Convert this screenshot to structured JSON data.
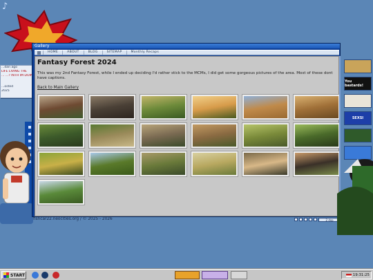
{
  "window": {
    "title": "Gallery",
    "nav": [
      "HOME",
      "ABOUT",
      "BLOG",
      "SITEMAP",
      "Monthly Recaps"
    ]
  },
  "page": {
    "title": "Fantasy Forest 2024",
    "description": "This was my 2nd Fantasy Forest, while I ended up deciding I'd rather stick to the MCMs, I did get some gorgeous pictures of the area. Most of these dont have captions.",
    "back_link": "Back to Main Gallery"
  },
  "thumbnails": [
    {
      "name": "village-street",
      "colors": [
        "#6e4a32",
        "#b8a58a",
        "#3f5a2e"
      ]
    },
    {
      "name": "stone-lane",
      "colors": [
        "#4a4036",
        "#8a7a66",
        "#2e2620"
      ]
    },
    {
      "name": "field-trees",
      "colors": [
        "#6d8a3a",
        "#c2b56a",
        "#3a5a22"
      ]
    },
    {
      "name": "sunset-field",
      "colors": [
        "#d79b4a",
        "#f1d08a",
        "#4a5a20"
      ]
    },
    {
      "name": "college-roof",
      "colors": [
        "#c08a4a",
        "#8fb0d8",
        "#9a6a32"
      ]
    },
    {
      "name": "golden-stone",
      "colors": [
        "#a07038",
        "#d8b070",
        "#6a4a22"
      ]
    },
    {
      "name": "garden-gate",
      "colors": [
        "#3c5a2a",
        "#6a8a3a",
        "#2a3a1c"
      ]
    },
    {
      "name": "cottage-row",
      "colors": [
        "#9a8a5a",
        "#5a7a32",
        "#c8b888"
      ]
    },
    {
      "name": "stone-cottage",
      "colors": [
        "#7a6a52",
        "#b8a47a",
        "#3a4a2a"
      ]
    },
    {
      "name": "manor-house",
      "colors": [
        "#8a6a42",
        "#c29a62",
        "#4a5a2a"
      ]
    },
    {
      "name": "country-road",
      "colors": [
        "#7a8a3a",
        "#b6c46a",
        "#4a5a2a"
      ]
    },
    {
      "name": "green-lane",
      "colors": [
        "#4a6a2a",
        "#9aba5a",
        "#2a3a1a"
      ]
    },
    {
      "name": "sunlit-canopy",
      "colors": [
        "#c9b048",
        "#8aa438",
        "#3a4a1c"
      ]
    },
    {
      "name": "tree-line",
      "colors": [
        "#5a7a2a",
        "#a8c8e8",
        "#3a5a1a"
      ]
    },
    {
      "name": "hillside-path",
      "colors": [
        "#6a7a3a",
        "#a89a6a",
        "#3a4a2a"
      ]
    },
    {
      "name": "sheep-meadow",
      "colors": [
        "#b8a860",
        "#d8d0a0",
        "#6a7a3a"
      ]
    },
    {
      "name": "evening-road",
      "colors": [
        "#d8b888",
        "#7a6a4a",
        "#3a3a2a"
      ]
    },
    {
      "name": "dark-gate",
      "colors": [
        "#3a3028",
        "#c89a6a",
        "#7a8a4a"
      ]
    },
    {
      "name": "hedge-field",
      "colors": [
        "#5a8a3a",
        "#c8d8e8",
        "#3a5a22"
      ]
    }
  ],
  "notification": {
    "line1": "...dan ago",
    "line2": "LIFE LIVING THE",
    "line3": "... ...? INTH IM DOING",
    "line4": "...osted",
    "line5": "2025"
  },
  "footer": {
    "text": "fishcar22.neocities.org / © 2025 - 2026",
    "badge": "2 dsp"
  },
  "ads": [
    {
      "name": "dogs-ad",
      "color": "#c9a45a"
    },
    {
      "name": "you-bastards-ad",
      "text": "You bastards!",
      "color": "#111111"
    },
    {
      "name": "pizza-ad",
      "color": "#e9e4d8"
    },
    {
      "name": "pepsi-ad",
      "text": "SEXSI",
      "color": "#1d3fa8"
    },
    {
      "name": "photo-ad",
      "color": "#2f5a2a"
    },
    {
      "name": "windows-ad",
      "color": "#3a7ad8"
    }
  ],
  "taskbar": {
    "start": "START",
    "clock": "19:31:25"
  },
  "colors": {
    "desktop": "#5b86b6",
    "window_frame": "#0e3f95",
    "content_bg": "#c8c8c8"
  }
}
